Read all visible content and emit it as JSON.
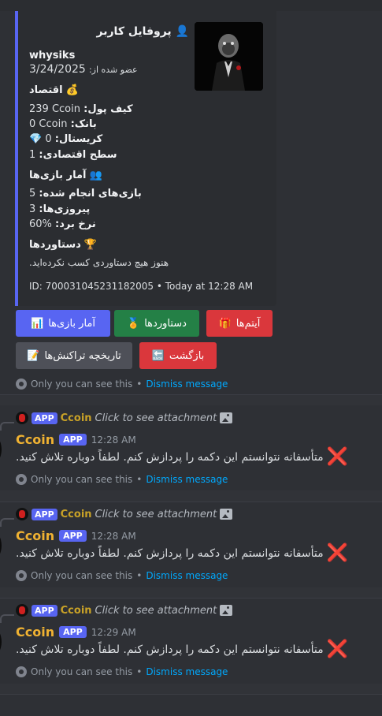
{
  "embed": {
    "title": "پروفایل کاربر",
    "title_icon": "👤",
    "username": "whysiks",
    "joined_label": "عضو شده از:",
    "joined_date": "3/24/2025",
    "economy": {
      "heading": "اقتصاد",
      "icon": "💰",
      "wallet_label": "کیف پول:",
      "wallet_value": "239 Ccoin",
      "bank_label": "بانک:",
      "bank_value": "0 Ccoin",
      "crystal_label": "کریستال:",
      "crystal_value": "0",
      "crystal_icon": "💎",
      "level_label": "سطح اقتصادی:",
      "level_value": "1"
    },
    "games": {
      "heading": "آمار بازی‌ها",
      "icon": "👥",
      "played_label": "بازی‌های انجام شده:",
      "played_value": "5",
      "wins_label": "پیروزی‌ها:",
      "wins_value": "3",
      "rate_label": "نرخ برد:",
      "rate_value": "60%"
    },
    "achievements": {
      "heading": "دستاوردها",
      "icon": "🏆",
      "empty_text": "هنوز هیچ دستاوردی کسب نکرده‌اید."
    },
    "footer": "ID: 700031045231182005 • Today at 12:28 AM"
  },
  "buttons": [
    {
      "label": "آمار بازی‌ها",
      "icon": "📊",
      "style": "blue"
    },
    {
      "label": "دستاوردها",
      "icon": "🏅",
      "style": "green"
    },
    {
      "label": "آیتم‌ها",
      "icon": "🎁",
      "style": "red"
    },
    {
      "label": "تاریخچه تراکنش‌ها",
      "icon": "📝",
      "style": "grey"
    },
    {
      "label": "بازگشت",
      "icon": "🔙",
      "style": "red"
    }
  ],
  "ephemeral": {
    "only_you": "Only you can see this",
    "separator": "•",
    "dismiss": "Dismiss message"
  },
  "messages": [
    {
      "reply_tag": "APP",
      "reply_name": "Ccoin",
      "reply_click": "Click to see attachment",
      "author": "Ccoin",
      "tag": "APP",
      "time": "12:28 AM",
      "text": "متأسفانه نتوانستم این دکمه را پردازش کنم. لطفاً دوباره تلاش کنید.",
      "x_icon": "❌"
    },
    {
      "reply_tag": "APP",
      "reply_name": "Ccoin",
      "reply_click": "Click to see attachment",
      "author": "Ccoin",
      "tag": "APP",
      "time": "12:28 AM",
      "text": "متأسفانه نتوانستم این دکمه را پردازش کنم. لطفاً دوباره تلاش کنید.",
      "x_icon": "❌"
    },
    {
      "reply_tag": "APP",
      "reply_name": "Ccoin",
      "reply_click": "Click to see attachment",
      "author": "Ccoin",
      "tag": "APP",
      "time": "12:29 AM",
      "text": "متأسفانه نتوانستم این دکمه را پردازش کنم. لطفاً دوباره تلاش کنید.",
      "x_icon": "❌"
    }
  ],
  "colors": {
    "background": "#313338",
    "embed_bg": "#2b2d31",
    "embed_accent": "#5865f2",
    "author": "#f0b232",
    "link": "#00a8fc",
    "error": "#da373c"
  }
}
